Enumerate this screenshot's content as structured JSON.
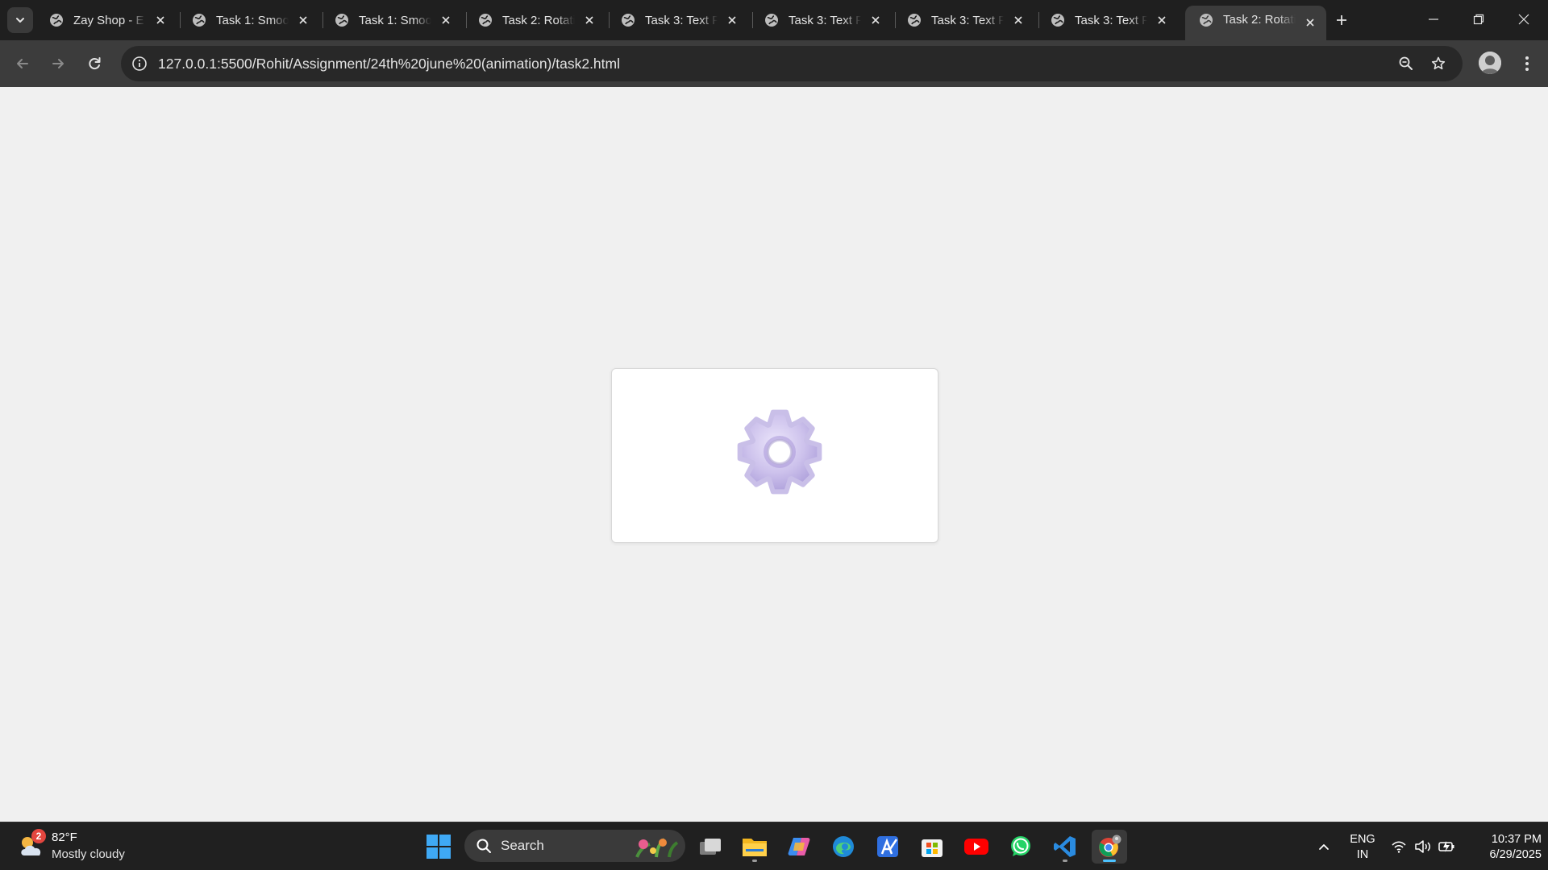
{
  "browser": {
    "tabs": [
      {
        "title": "Zay Shop - E",
        "active": false
      },
      {
        "title": "Task 1: Smoo",
        "active": false
      },
      {
        "title": "Task 1: Smoo",
        "active": false
      },
      {
        "title": "Task 2: Rotati",
        "active": false
      },
      {
        "title": "Task 3: Text F",
        "active": false
      },
      {
        "title": "Task 3: Text F",
        "active": false
      },
      {
        "title": "Task 3: Text F",
        "active": false
      },
      {
        "title": "Task 3: Text F",
        "active": false
      },
      {
        "title": "Task 2: Rotati",
        "active": true
      }
    ],
    "url": "127.0.0.1:5500/Rohit/Assignment/24th%20june%20(animation)/task2.html"
  },
  "page": {
    "gear_color": "#c9bfe8"
  },
  "taskbar": {
    "weather": {
      "temp": "82°F",
      "condition": "Mostly cloudy",
      "badge": "2"
    },
    "search_label": "Search",
    "language": {
      "line1": "ENG",
      "line2": "IN"
    },
    "clock": {
      "time": "10:37 PM",
      "date": "6/29/2025"
    }
  }
}
